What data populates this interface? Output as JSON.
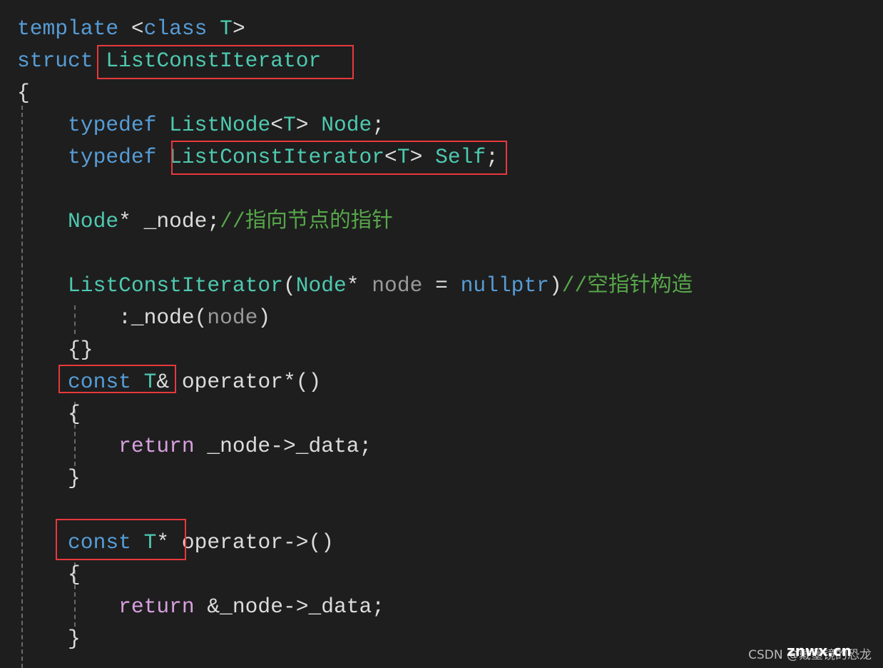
{
  "colors": {
    "background": "#1e1e1e",
    "keyword": "#569cd6",
    "type": "#4ec9b0",
    "text": "#dcdcdc",
    "comment": "#57a64a",
    "parameter": "#9a9a9a",
    "control": "#d8a0df",
    "highlight_box": "#e8383d"
  },
  "code_lines": [
    [
      [
        "kw",
        "template"
      ],
      [
        "tx",
        " <"
      ],
      [
        "kw",
        "class"
      ],
      [
        "tx",
        " "
      ],
      [
        "ty",
        "T"
      ],
      [
        "tx",
        ">"
      ]
    ],
    [
      [
        "kw",
        "struct"
      ],
      [
        "tx",
        " "
      ],
      [
        "ty",
        "ListConstIterator"
      ]
    ],
    [
      [
        "tx",
        "{"
      ]
    ],
    [
      [
        "tx",
        "    "
      ],
      [
        "kw",
        "typedef"
      ],
      [
        "tx",
        " "
      ],
      [
        "ty",
        "ListNode"
      ],
      [
        "tx",
        "<"
      ],
      [
        "ty",
        "T"
      ],
      [
        "tx",
        "> "
      ],
      [
        "ty",
        "Node"
      ],
      [
        "tx",
        ";"
      ]
    ],
    [
      [
        "tx",
        "    "
      ],
      [
        "kw",
        "typedef"
      ],
      [
        "tx",
        " "
      ],
      [
        "ty",
        "ListConstIterator"
      ],
      [
        "tx",
        "<"
      ],
      [
        "ty",
        "T"
      ],
      [
        "tx",
        "> "
      ],
      [
        "ty",
        "Self"
      ],
      [
        "tx",
        ";"
      ]
    ],
    [],
    [
      [
        "tx",
        "    "
      ],
      [
        "ty",
        "Node"
      ],
      [
        "tx",
        "* _node;"
      ],
      [
        "cm",
        "//指向节点的指针"
      ]
    ],
    [],
    [
      [
        "tx",
        "    "
      ],
      [
        "ty",
        "ListConstIterator"
      ],
      [
        "tx",
        "("
      ],
      [
        "ty",
        "Node"
      ],
      [
        "tx",
        "* "
      ],
      [
        "pm",
        "node"
      ],
      [
        "tx",
        " = "
      ],
      [
        "kw",
        "nullptr"
      ],
      [
        "tx",
        ")"
      ],
      [
        "cm",
        "//空指针构造"
      ]
    ],
    [
      [
        "tx",
        "        :_node("
      ],
      [
        "pm",
        "node"
      ],
      [
        "tx",
        ")"
      ]
    ],
    [
      [
        "tx",
        "    {}"
      ]
    ],
    [
      [
        "tx",
        "    "
      ],
      [
        "kw",
        "const"
      ],
      [
        "tx",
        " "
      ],
      [
        "ty",
        "T"
      ],
      [
        "tx",
        "& operator*()"
      ]
    ],
    [
      [
        "tx",
        "    {"
      ]
    ],
    [
      [
        "tx",
        "        "
      ],
      [
        "rt",
        "return"
      ],
      [
        "tx",
        " _node->_data;"
      ]
    ],
    [
      [
        "tx",
        "    }"
      ]
    ],
    [],
    [
      [
        "tx",
        "    "
      ],
      [
        "kw",
        "const"
      ],
      [
        "tx",
        " "
      ],
      [
        "ty",
        "T"
      ],
      [
        "tx",
        "* operator->()"
      ]
    ],
    [
      [
        "tx",
        "    {"
      ]
    ],
    [
      [
        "tx",
        "        "
      ],
      [
        "rt",
        "return"
      ],
      [
        "tx",
        " &_node->_data;"
      ]
    ],
    [
      [
        "tx",
        "    }"
      ]
    ]
  ],
  "watermark": {
    "text": "CSDN @戴墨镜的恐龙",
    "overlay": "znwx.cn"
  }
}
